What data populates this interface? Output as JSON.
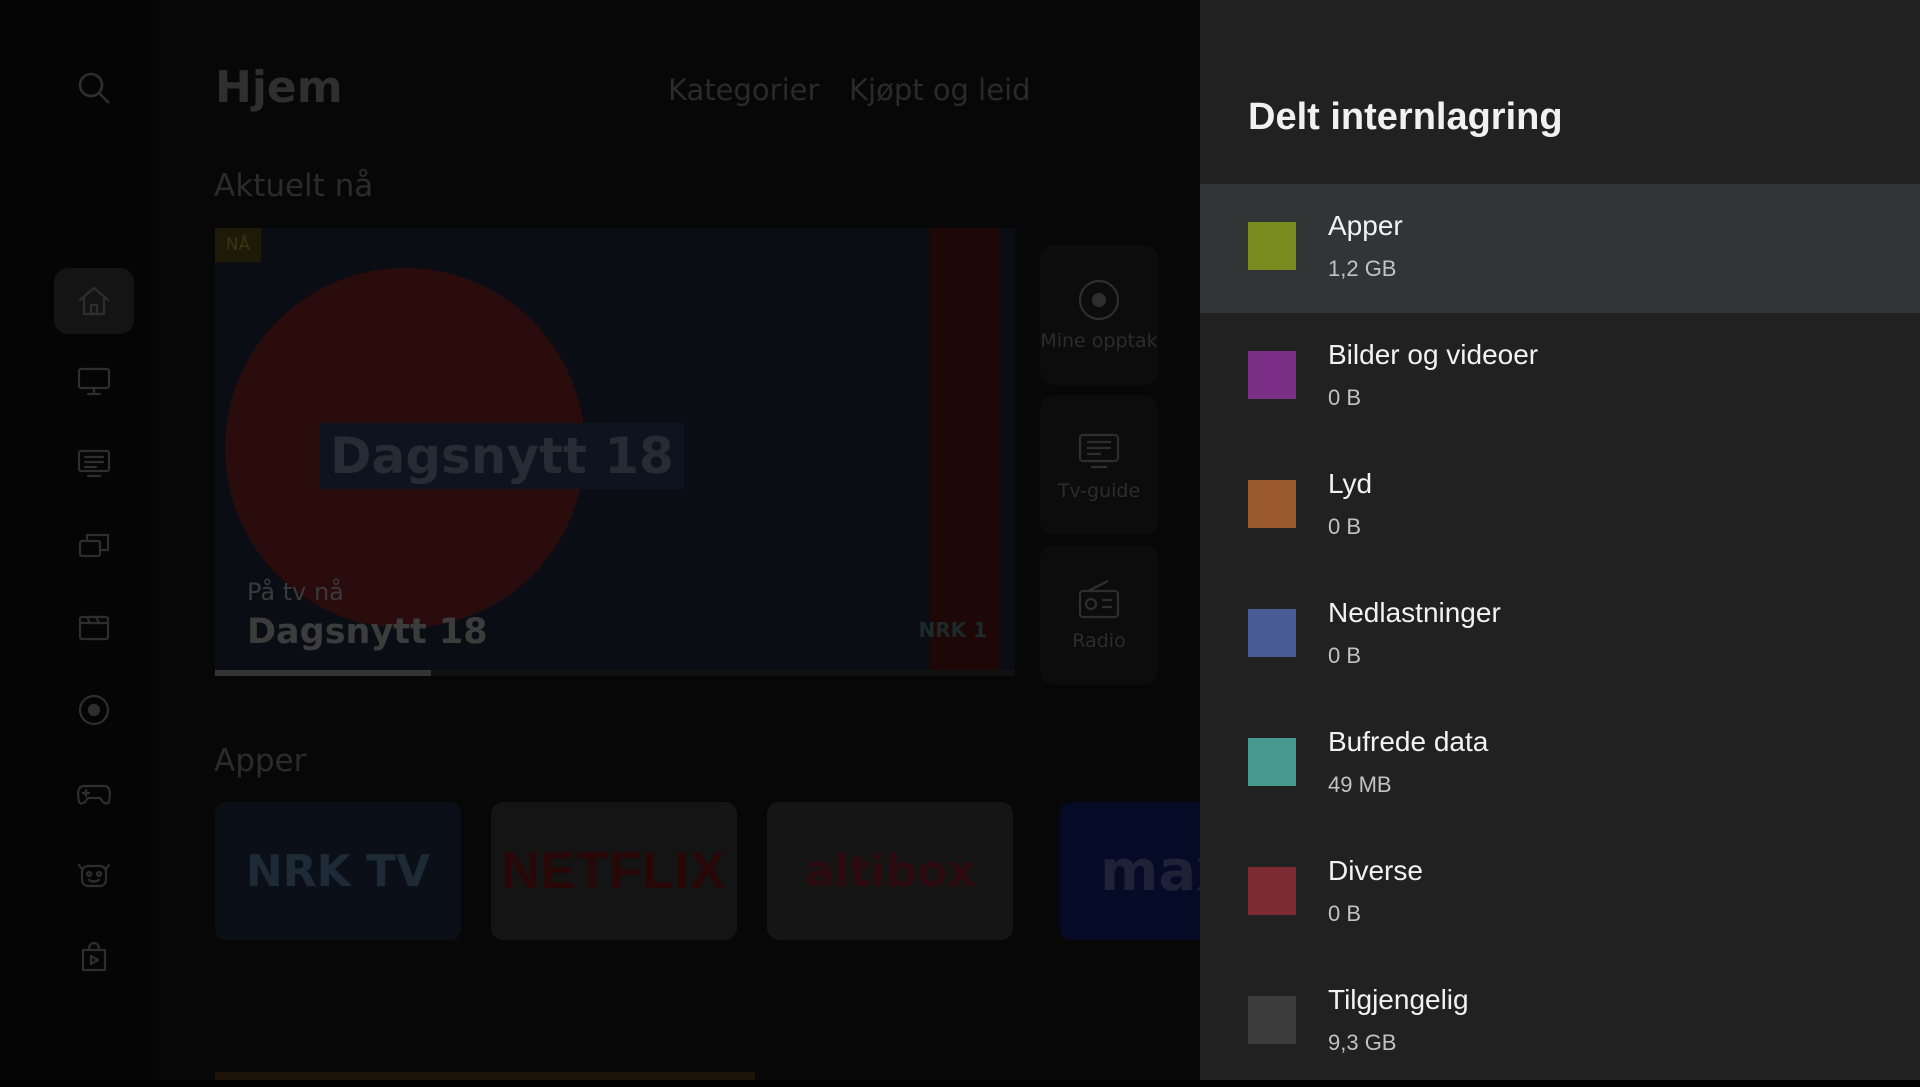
{
  "panel": {
    "title": "Delt internlagring",
    "items": [
      {
        "label": "Apper",
        "size": "1,2 GB",
        "color": "#7a8b20",
        "focused": true
      },
      {
        "label": "Bilder og videoer",
        "size": "0 B",
        "color": "#7b2f86"
      },
      {
        "label": "Lyd",
        "size": "0 B",
        "color": "#9b5a2e"
      },
      {
        "label": "Nedlastninger",
        "size": "0 B",
        "color": "#4a5c96"
      },
      {
        "label": "Bufrede data",
        "size": "49 MB",
        "color": "#479a8d"
      },
      {
        "label": "Diverse",
        "size": "0 B",
        "color": "#7e2a33"
      },
      {
        "label": "Tilgjengelig",
        "size": "9,3 GB",
        "color": "#3c3c3c"
      }
    ]
  },
  "background": {
    "title": "Hjem",
    "tabs": [
      "Kategorier",
      "Kjøpt og leid"
    ],
    "section_now": "Aktuelt nå",
    "section_apps": "Apper",
    "hero": {
      "badge": "NÅ",
      "show_graphic": "Dagsnytt 18",
      "subtitle": "På tv nå",
      "name": "Dagsnytt 18",
      "channel_logo": "NRK 1",
      "progress": 0.27
    },
    "shortcuts": [
      "Mine opptak",
      "Tv-guide",
      "Radio"
    ],
    "apps": [
      "NRK TV",
      "NETFLIX",
      "altibox",
      "max"
    ],
    "rail_icons": [
      "home-icon",
      "tv-icon",
      "guide-icon",
      "multiscreen-icon",
      "movie-icon",
      "record-icon",
      "gamepad-icon",
      "kids-icon",
      "play-store-icon"
    ]
  }
}
